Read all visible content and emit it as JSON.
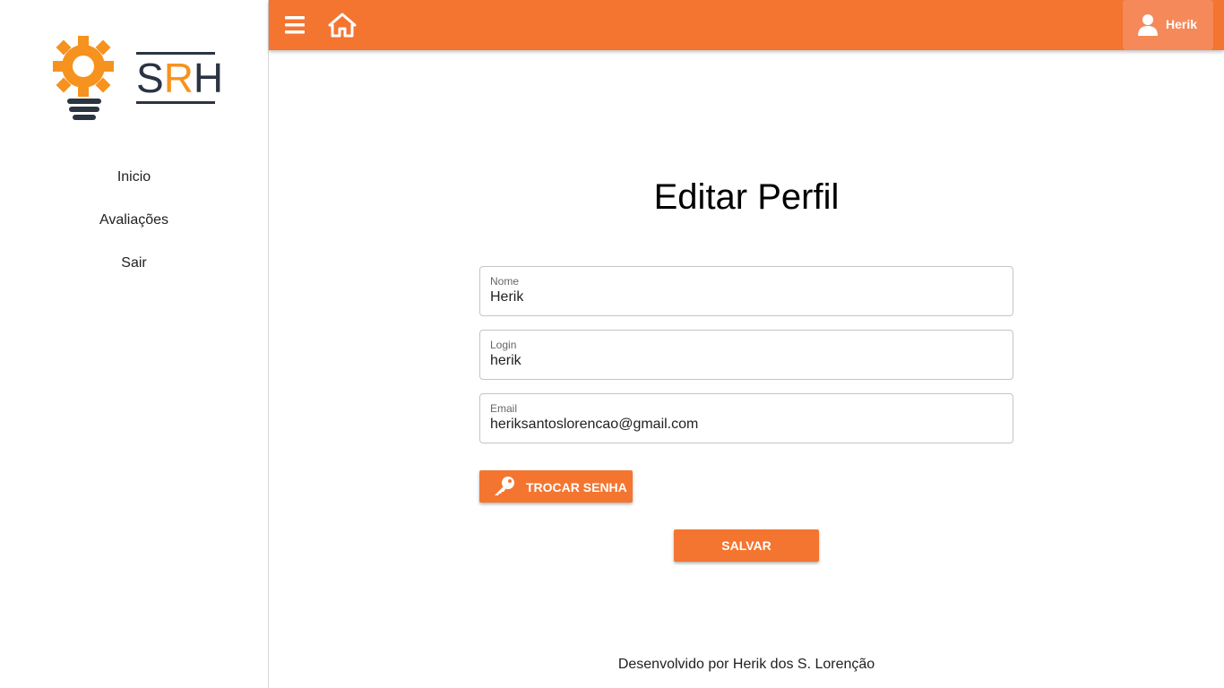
{
  "sidebar": {
    "logo": {
      "text_s": "S",
      "text_r": "R",
      "text_h": "H",
      "icon": "lightbulb-gear-icon"
    },
    "items": [
      {
        "label": "Inicio"
      },
      {
        "label": "Avaliações"
      },
      {
        "label": "Sair"
      }
    ]
  },
  "header": {
    "menu_icon": "hamburger-menu-icon",
    "home_icon": "home-icon",
    "user": {
      "name": "Herik",
      "icon": "user-icon"
    }
  },
  "main": {
    "title": "Editar Perfil",
    "fields": {
      "nome": {
        "label": "Nome",
        "value": "Herik"
      },
      "login": {
        "label": "Login",
        "value": "herik"
      },
      "email": {
        "label": "Email",
        "value": "heriksantoslorencao@gmail.com"
      }
    },
    "change_password_label": "Trocar Senha",
    "save_label": "Salvar"
  },
  "footer": {
    "text": "Desenvolvido por Herik dos S. Lorenção"
  },
  "colors": {
    "accent": "#f47530",
    "logo_orange": "#f6921e",
    "logo_dark": "#2b3441"
  }
}
